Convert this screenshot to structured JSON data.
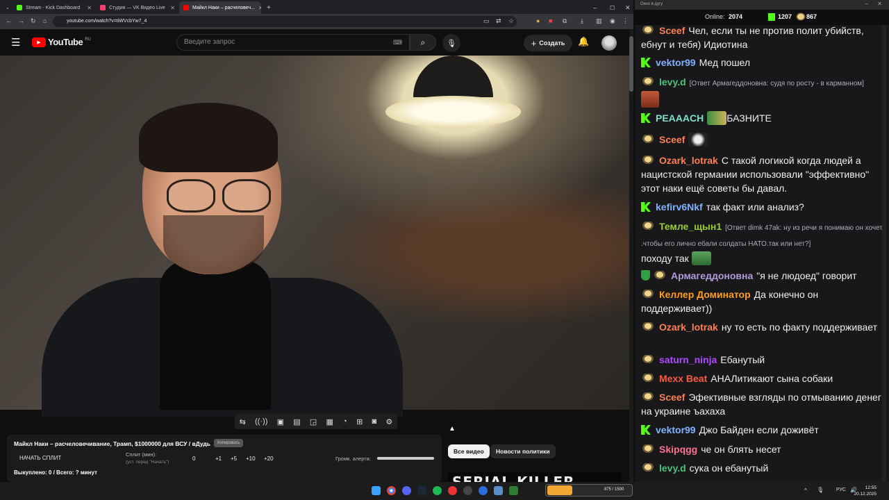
{
  "browser": {
    "tabs": [
      {
        "label": "Stream - Kick Dashboard",
        "color": "#53fc18"
      },
      {
        "label": "Студия — VK Видео Live",
        "color": "#ff3e6e"
      },
      {
        "label": "Майкл Наки – расчеловеч...",
        "color": "#ff0000"
      }
    ],
    "url": "youtube.com/watch?v=tiWVcbYw7_4",
    "new_tab": "+"
  },
  "youtube": {
    "logo_text": "YouTube",
    "region": "RU",
    "search_placeholder": "Введите запрос",
    "create_label": "Создать"
  },
  "panel": {
    "title": "Майкл Наки – расчеловечивание, Трамп, $1000000 для ВСУ / вДудь",
    "copy_badge": "Копировать",
    "split_button": "НАЧАТЬ СПЛИТ",
    "split_label": "Сплит (мин):",
    "split_sub": "(уст. перед \"Начать\")",
    "split_value": "0",
    "increments": [
      "+1",
      "+5",
      "+10",
      "+20"
    ],
    "alert_volume_label": "Громк. алерта:",
    "alert_volume_level": 1.0,
    "footer": "Выкуплено: 0 / Всего: ? минут"
  },
  "chips": {
    "all_videos": "Все видео",
    "politics_news": "Новости политики"
  },
  "thumbnail_text": "SERIAL KILLER",
  "chat": {
    "window_title": "Окно в дугу",
    "online_label": "Online:",
    "online_count": "2074",
    "kick_count": "1207",
    "other_count": "867",
    "messages": [
      {
        "user": "Sceef",
        "color": "#ff7f50",
        "badge": "m",
        "text": "Чел, если ты не против полит убийств, ебнут и тебя) Идиотина"
      },
      {
        "user": "vektor99",
        "color": "#7fb2ff",
        "badge": "k",
        "text": "Мед пошел"
      },
      {
        "user": "levy.d",
        "color": "#4cc27a",
        "badge": "m",
        "reply": "[Ответ Армагеддоновна: судя по росту - в карманном]",
        "text": ""
      },
      {
        "user": "PEAAACH",
        "color": "#7fe0c8",
        "badge": "k",
        "text": "БАЗНИТЕ"
      },
      {
        "user": "Sceef",
        "color": "#ff7f50",
        "badge": "m",
        "text": ""
      },
      {
        "user": "Ozark_lotrak",
        "color": "#ff7f50",
        "badge": "m",
        "text": "С такой логикой когда людей а нацистской германии использовали \"эффективно\" этот наки ещё советы бы давал."
      },
      {
        "user": "kefirv6Nkf",
        "color": "#7fb2ff",
        "badge": "k",
        "text": "так факт или анализ?"
      },
      {
        "user": "Темле_щын1",
        "color": "#9acd32",
        "badge": "m",
        "reply": "[Ответ dimk 47ak: ну из речи я понимаю он хочет .чтобы его лично ебали солдаты НАТО.так или нет?]",
        "text": "походу так"
      },
      {
        "user": "Армагеддоновна",
        "color": "#b19cd9",
        "badge": "shield",
        "text": "\"я не людоед\" говорит"
      },
      {
        "user": "Келлер Доминатор",
        "color": "#ff9f1c",
        "badge": "m",
        "text": "Да конечно он поддерживает))"
      },
      {
        "user": "Ozark_lotrak",
        "color": "#ff7f50",
        "badge": "m",
        "text": "ну то есть по факту поддерживает"
      },
      {
        "user": "saturn_ninja",
        "color": "#b048ff",
        "badge": "m",
        "text": "Ебанутый"
      },
      {
        "user": "Mexx Beat",
        "color": "#ff5a3c",
        "badge": "m",
        "text": "АНАЛитикают сына собаки"
      },
      {
        "user": "Sceef",
        "color": "#ff7f50",
        "badge": "m",
        "text": "Эфективные взгляды по отмыванию денег на украине ъахаха"
      },
      {
        "user": "vektor99",
        "color": "#7fb2ff",
        "badge": "k",
        "text": "Джо Байден если доживёт"
      },
      {
        "user": "Skipqgg",
        "color": "#ff6f91",
        "badge": "m",
        "text": "че он блять несет"
      },
      {
        "user": "levy.d",
        "color": "#4cc27a",
        "badge": "m",
        "text": "сука он ебанутый"
      }
    ]
  },
  "taskbar": {
    "game_counter": "875 / 1500",
    "lang": "РУС",
    "time": "12:55",
    "date": "20.12.2025"
  }
}
